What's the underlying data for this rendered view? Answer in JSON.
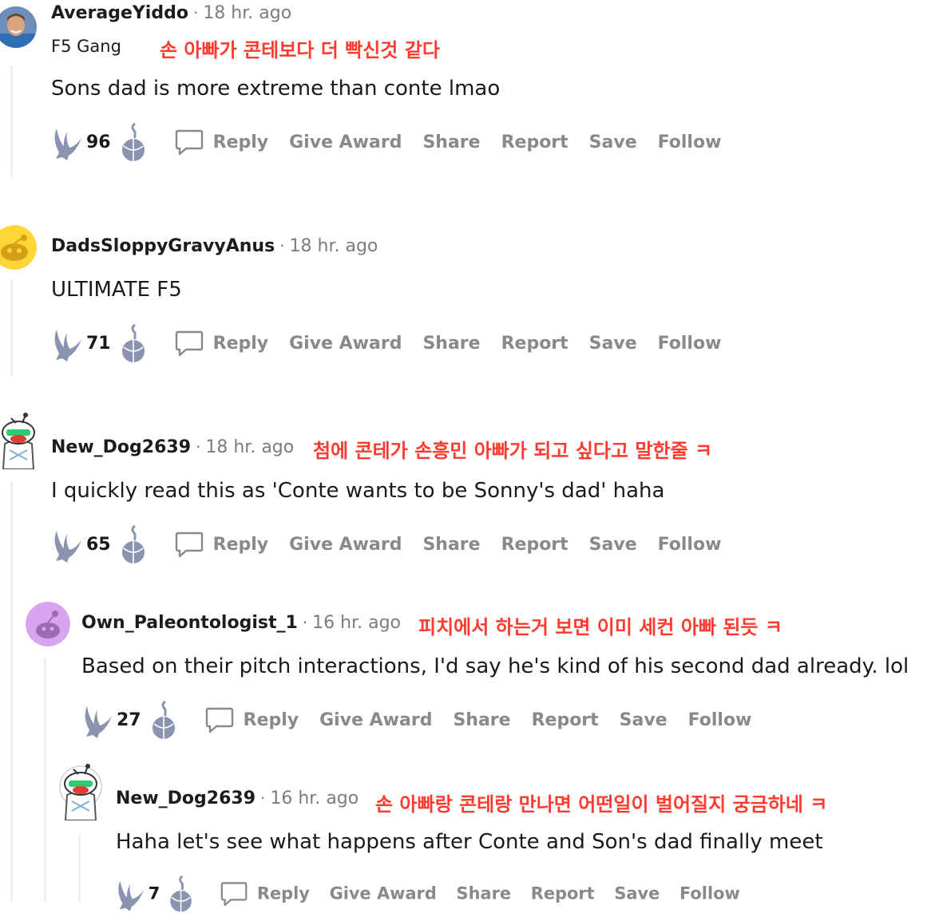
{
  "comments": [
    {
      "username": "AverageYiddo",
      "time": "18 hr. ago",
      "flair": "F5 Gang",
      "translation": "손 아빠가 콘테보다 더 빡신것 같다",
      "body": "Sons dad is more extreme than conte lmao",
      "score": "96",
      "actions": {
        "reply": "Reply",
        "award": "Give Award",
        "share": "Share",
        "report": "Report",
        "save": "Save",
        "follow": "Follow"
      }
    },
    {
      "username": "DadsSloppyGravyAnus",
      "time": "18 hr. ago",
      "body": "ULTIMATE F5",
      "score": "71",
      "actions": {
        "reply": "Reply",
        "award": "Give Award",
        "share": "Share",
        "report": "Report",
        "save": "Save",
        "follow": "Follow"
      }
    },
    {
      "username": "New_Dog2639",
      "time": "18 hr. ago",
      "translation": "첨에 콘테가 손흥민 아빠가 되고 싶다고 말한줄 ㅋ",
      "body": "I quickly read this as 'Conte wants to be Sonny's dad' haha",
      "score": "65",
      "actions": {
        "reply": "Reply",
        "award": "Give Award",
        "share": "Share",
        "report": "Report",
        "save": "Save",
        "follow": "Follow"
      }
    },
    {
      "username": "Own_Paleontologist_1",
      "time": "16 hr. ago",
      "translation": "피치에서 하는거 보면 이미 세컨 아빠 된듯 ㅋ",
      "body": "Based on their pitch interactions, I'd say he's kind of his second dad already. lol",
      "score": "27",
      "actions": {
        "reply": "Reply",
        "award": "Give Award",
        "share": "Share",
        "report": "Report",
        "save": "Save",
        "follow": "Follow"
      }
    },
    {
      "username": "New_Dog2639",
      "time": "16 hr. ago",
      "translation": "손 아빠랑 콘테랑 만나면 어떤일이 벌어질지 궁금하네 ㅋ",
      "body": "Haha let's see what happens after Conte and Son's dad finally meet",
      "score": "7",
      "actions": {
        "reply": "Reply",
        "award": "Give Award",
        "share": "Share",
        "report": "Report",
        "save": "Save",
        "follow": "Follow"
      }
    }
  ],
  "colors": {
    "translation": "#ff3b30",
    "muted": "#878a8c",
    "vote_icon": "#8a93b0"
  }
}
